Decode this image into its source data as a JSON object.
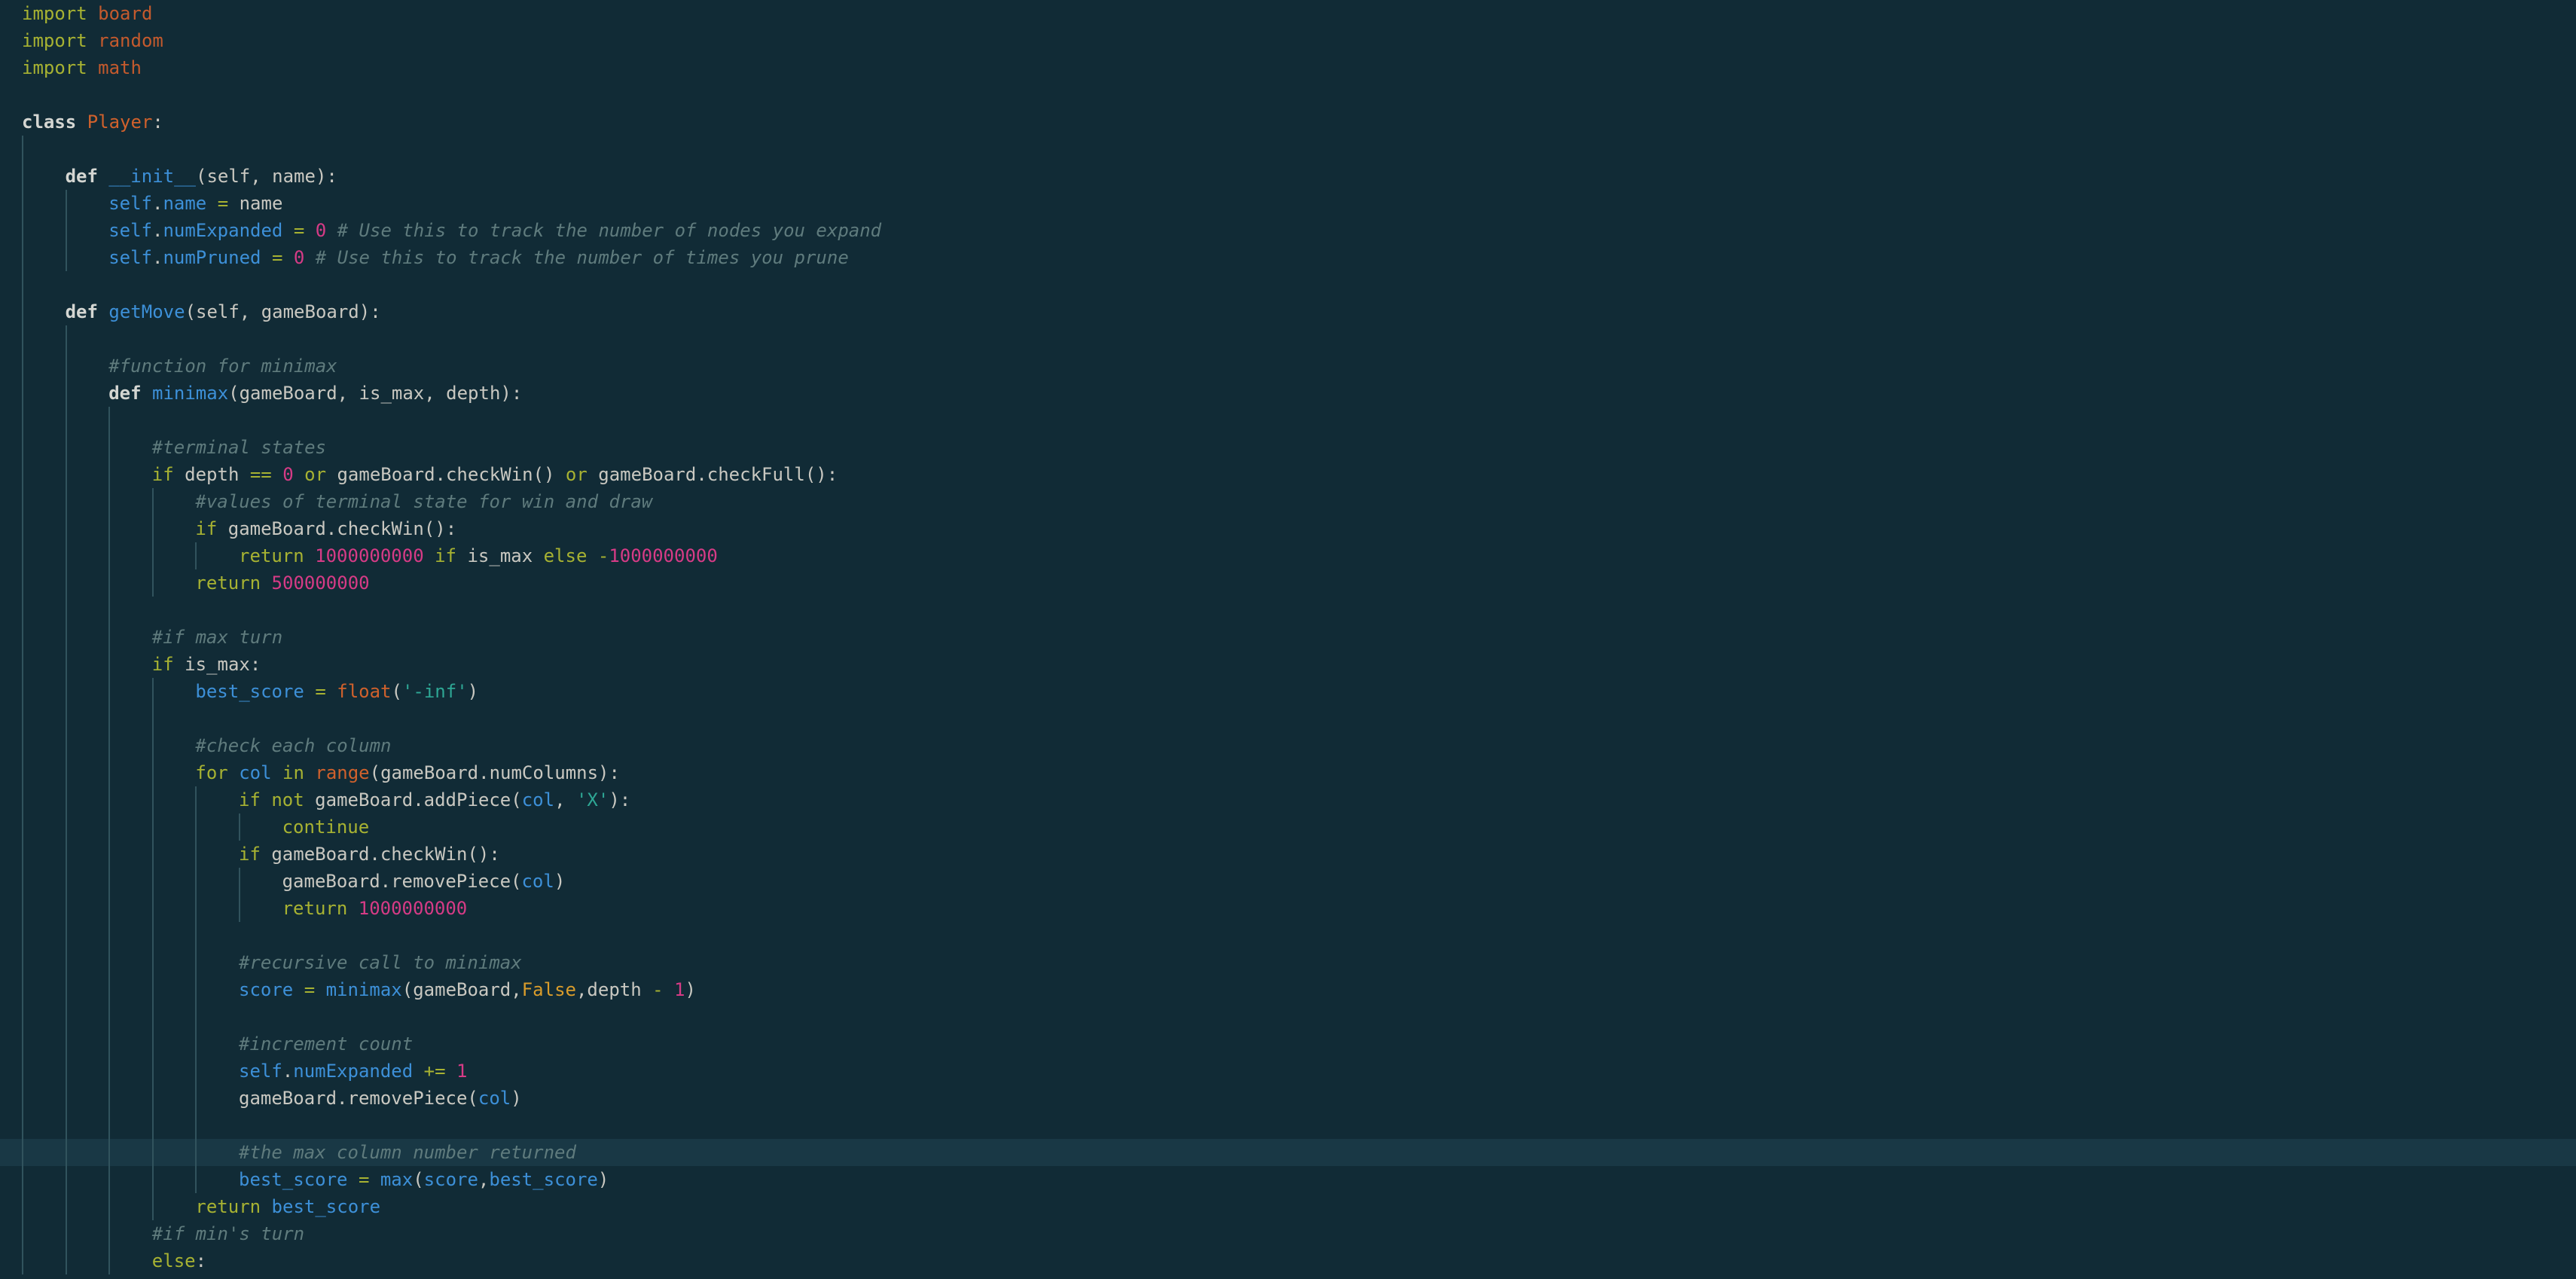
{
  "editor": {
    "current_line_index": 42,
    "lines": [
      {
        "indent": 0,
        "tokens": [
          {
            "t": "import",
            "c": "kw"
          },
          {
            "t": " ",
            "c": "plain"
          },
          {
            "t": "board",
            "c": "module"
          }
        ]
      },
      {
        "indent": 0,
        "tokens": [
          {
            "t": "import",
            "c": "kw"
          },
          {
            "t": " ",
            "c": "plain"
          },
          {
            "t": "random",
            "c": "module"
          }
        ]
      },
      {
        "indent": 0,
        "tokens": [
          {
            "t": "import",
            "c": "kw"
          },
          {
            "t": " ",
            "c": "plain"
          },
          {
            "t": "math",
            "c": "module"
          }
        ]
      },
      {
        "indent": 0,
        "tokens": []
      },
      {
        "indent": 0,
        "tokens": [
          {
            "t": "class",
            "c": "kwb"
          },
          {
            "t": " ",
            "c": "plain"
          },
          {
            "t": "Player",
            "c": "cls"
          },
          {
            "t": ":",
            "c": "plain"
          }
        ]
      },
      {
        "indent": 1,
        "tokens": []
      },
      {
        "indent": 1,
        "tokens": [
          {
            "t": "def",
            "c": "kwb"
          },
          {
            "t": " ",
            "c": "plain"
          },
          {
            "t": "__init__",
            "c": "fn"
          },
          {
            "t": "(self, name):",
            "c": "plain"
          }
        ]
      },
      {
        "indent": 2,
        "tokens": [
          {
            "t": "self",
            "c": "fn"
          },
          {
            "t": ".",
            "c": "plain"
          },
          {
            "t": "name",
            "c": "fn"
          },
          {
            "t": " ",
            "c": "plain"
          },
          {
            "t": "=",
            "c": "op"
          },
          {
            "t": " name",
            "c": "plain"
          }
        ]
      },
      {
        "indent": 2,
        "tokens": [
          {
            "t": "self",
            "c": "fn"
          },
          {
            "t": ".",
            "c": "plain"
          },
          {
            "t": "numExpanded",
            "c": "fn"
          },
          {
            "t": " ",
            "c": "plain"
          },
          {
            "t": "=",
            "c": "op"
          },
          {
            "t": " ",
            "c": "plain"
          },
          {
            "t": "0",
            "c": "num"
          },
          {
            "t": " ",
            "c": "plain"
          },
          {
            "t": "# Use this to track the number of nodes you expand",
            "c": "comment"
          }
        ]
      },
      {
        "indent": 2,
        "tokens": [
          {
            "t": "self",
            "c": "fn"
          },
          {
            "t": ".",
            "c": "plain"
          },
          {
            "t": "numPruned",
            "c": "fn"
          },
          {
            "t": " ",
            "c": "plain"
          },
          {
            "t": "=",
            "c": "op"
          },
          {
            "t": " ",
            "c": "plain"
          },
          {
            "t": "0",
            "c": "num"
          },
          {
            "t": " ",
            "c": "plain"
          },
          {
            "t": "# Use this to track the number of times you prune",
            "c": "comment"
          }
        ]
      },
      {
        "indent": 1,
        "tokens": []
      },
      {
        "indent": 1,
        "tokens": [
          {
            "t": "def",
            "c": "kwb"
          },
          {
            "t": " ",
            "c": "plain"
          },
          {
            "t": "getMove",
            "c": "fn"
          },
          {
            "t": "(self, gameBoard):",
            "c": "plain"
          }
        ]
      },
      {
        "indent": 2,
        "tokens": []
      },
      {
        "indent": 2,
        "tokens": [
          {
            "t": "#function for minimax",
            "c": "comment"
          }
        ]
      },
      {
        "indent": 2,
        "tokens": [
          {
            "t": "def",
            "c": "kwb"
          },
          {
            "t": " ",
            "c": "plain"
          },
          {
            "t": "minimax",
            "c": "fn"
          },
          {
            "t": "(gameBoard, is_max, depth):",
            "c": "plain"
          }
        ]
      },
      {
        "indent": 3,
        "tokens": []
      },
      {
        "indent": 3,
        "tokens": [
          {
            "t": "#terminal states",
            "c": "comment"
          }
        ]
      },
      {
        "indent": 3,
        "tokens": [
          {
            "t": "if",
            "c": "kw"
          },
          {
            "t": " depth ",
            "c": "plain"
          },
          {
            "t": "==",
            "c": "op"
          },
          {
            "t": " ",
            "c": "plain"
          },
          {
            "t": "0",
            "c": "num"
          },
          {
            "t": " ",
            "c": "plain"
          },
          {
            "t": "or",
            "c": "kw"
          },
          {
            "t": " gameBoard.checkWin() ",
            "c": "plain"
          },
          {
            "t": "or",
            "c": "kw"
          },
          {
            "t": " gameBoard.checkFull():",
            "c": "plain"
          }
        ]
      },
      {
        "indent": 4,
        "tokens": [
          {
            "t": "#values of terminal state for win and draw",
            "c": "comment"
          }
        ]
      },
      {
        "indent": 4,
        "tokens": [
          {
            "t": "if",
            "c": "kw"
          },
          {
            "t": " gameBoard.checkWin():",
            "c": "plain"
          }
        ]
      },
      {
        "indent": 5,
        "tokens": [
          {
            "t": "return",
            "c": "kw"
          },
          {
            "t": " ",
            "c": "plain"
          },
          {
            "t": "1000000000",
            "c": "num"
          },
          {
            "t": " ",
            "c": "plain"
          },
          {
            "t": "if",
            "c": "kw"
          },
          {
            "t": " is_max ",
            "c": "plain"
          },
          {
            "t": "else",
            "c": "kw"
          },
          {
            "t": " ",
            "c": "plain"
          },
          {
            "t": "-",
            "c": "op"
          },
          {
            "t": "1000000000",
            "c": "num"
          }
        ]
      },
      {
        "indent": 4,
        "tokens": [
          {
            "t": "return",
            "c": "kw"
          },
          {
            "t": " ",
            "c": "plain"
          },
          {
            "t": "500000000",
            "c": "num"
          }
        ]
      },
      {
        "indent": 3,
        "tokens": []
      },
      {
        "indent": 3,
        "tokens": [
          {
            "t": "#if max turn",
            "c": "comment"
          }
        ]
      },
      {
        "indent": 3,
        "tokens": [
          {
            "t": "if",
            "c": "kw"
          },
          {
            "t": " is_max:",
            "c": "plain"
          }
        ]
      },
      {
        "indent": 4,
        "tokens": [
          {
            "t": "best_score",
            "c": "fn"
          },
          {
            "t": " ",
            "c": "plain"
          },
          {
            "t": "=",
            "c": "op"
          },
          {
            "t": " ",
            "c": "plain"
          },
          {
            "t": "float",
            "c": "builtin"
          },
          {
            "t": "(",
            "c": "plain"
          },
          {
            "t": "'-inf'",
            "c": "str"
          },
          {
            "t": ")",
            "c": "plain"
          }
        ]
      },
      {
        "indent": 4,
        "tokens": []
      },
      {
        "indent": 4,
        "tokens": [
          {
            "t": "#check each column",
            "c": "comment"
          }
        ]
      },
      {
        "indent": 4,
        "tokens": [
          {
            "t": "for",
            "c": "kw"
          },
          {
            "t": " ",
            "c": "plain"
          },
          {
            "t": "col",
            "c": "fn"
          },
          {
            "t": " ",
            "c": "plain"
          },
          {
            "t": "in",
            "c": "kw"
          },
          {
            "t": " ",
            "c": "plain"
          },
          {
            "t": "range",
            "c": "builtin"
          },
          {
            "t": "(gameBoard.numColumns):",
            "c": "plain"
          }
        ]
      },
      {
        "indent": 5,
        "tokens": [
          {
            "t": "if",
            "c": "kw"
          },
          {
            "t": " ",
            "c": "plain"
          },
          {
            "t": "not",
            "c": "kw"
          },
          {
            "t": " gameBoard.addPiece(",
            "c": "plain"
          },
          {
            "t": "col",
            "c": "fn"
          },
          {
            "t": ", ",
            "c": "plain"
          },
          {
            "t": "'X'",
            "c": "str"
          },
          {
            "t": "):",
            "c": "plain"
          }
        ]
      },
      {
        "indent": 6,
        "tokens": [
          {
            "t": "continue",
            "c": "kw"
          }
        ]
      },
      {
        "indent": 5,
        "tokens": [
          {
            "t": "if",
            "c": "kw"
          },
          {
            "t": " gameBoard.checkWin():",
            "c": "plain"
          }
        ]
      },
      {
        "indent": 6,
        "tokens": [
          {
            "t": "gameBoard.removePiece(",
            "c": "plain"
          },
          {
            "t": "col",
            "c": "fn"
          },
          {
            "t": ")",
            "c": "plain"
          }
        ]
      },
      {
        "indent": 6,
        "tokens": [
          {
            "t": "return",
            "c": "kw"
          },
          {
            "t": " ",
            "c": "plain"
          },
          {
            "t": "1000000000",
            "c": "num"
          }
        ]
      },
      {
        "indent": 5,
        "tokens": []
      },
      {
        "indent": 5,
        "tokens": [
          {
            "t": "#recursive call to minimax",
            "c": "comment"
          }
        ]
      },
      {
        "indent": 5,
        "tokens": [
          {
            "t": "score",
            "c": "fn"
          },
          {
            "t": " ",
            "c": "plain"
          },
          {
            "t": "=",
            "c": "op"
          },
          {
            "t": " ",
            "c": "plain"
          },
          {
            "t": "minimax",
            "c": "fn"
          },
          {
            "t": "(gameBoard,",
            "c": "plain"
          },
          {
            "t": "False",
            "c": "const"
          },
          {
            "t": ",depth ",
            "c": "plain"
          },
          {
            "t": "-",
            "c": "op"
          },
          {
            "t": " ",
            "c": "plain"
          },
          {
            "t": "1",
            "c": "num"
          },
          {
            "t": ")",
            "c": "plain"
          }
        ]
      },
      {
        "indent": 5,
        "tokens": []
      },
      {
        "indent": 5,
        "tokens": [
          {
            "t": "#increment count",
            "c": "comment"
          }
        ]
      },
      {
        "indent": 5,
        "tokens": [
          {
            "t": "self",
            "c": "fn"
          },
          {
            "t": ".",
            "c": "plain"
          },
          {
            "t": "numExpanded",
            "c": "fn"
          },
          {
            "t": " ",
            "c": "plain"
          },
          {
            "t": "+=",
            "c": "op"
          },
          {
            "t": " ",
            "c": "plain"
          },
          {
            "t": "1",
            "c": "num"
          }
        ]
      },
      {
        "indent": 5,
        "tokens": [
          {
            "t": "gameBoard.removePiece(",
            "c": "plain"
          },
          {
            "t": "col",
            "c": "fn"
          },
          {
            "t": ")",
            "c": "plain"
          }
        ]
      },
      {
        "indent": 5,
        "tokens": []
      },
      {
        "indent": 5,
        "tokens": [
          {
            "t": "#the max column number returned",
            "c": "comment"
          }
        ]
      },
      {
        "indent": 5,
        "tokens": [
          {
            "t": "best_score",
            "c": "fn"
          },
          {
            "t": " ",
            "c": "plain"
          },
          {
            "t": "=",
            "c": "op"
          },
          {
            "t": " ",
            "c": "plain"
          },
          {
            "t": "max",
            "c": "fn"
          },
          {
            "t": "(",
            "c": "plain"
          },
          {
            "t": "score",
            "c": "fn"
          },
          {
            "t": ",",
            "c": "plain"
          },
          {
            "t": "best_score",
            "c": "fn"
          },
          {
            "t": ")",
            "c": "plain"
          }
        ]
      },
      {
        "indent": 4,
        "tokens": [
          {
            "t": "return",
            "c": "kw"
          },
          {
            "t": " ",
            "c": "plain"
          },
          {
            "t": "best_score",
            "c": "fn"
          }
        ]
      },
      {
        "indent": 3,
        "tokens": [
          {
            "t": "#if min's turn",
            "c": "comment"
          }
        ]
      },
      {
        "indent": 3,
        "tokens": [
          {
            "t": "else",
            "c": "kw"
          },
          {
            "t": ":",
            "c": "plain"
          }
        ]
      }
    ]
  }
}
